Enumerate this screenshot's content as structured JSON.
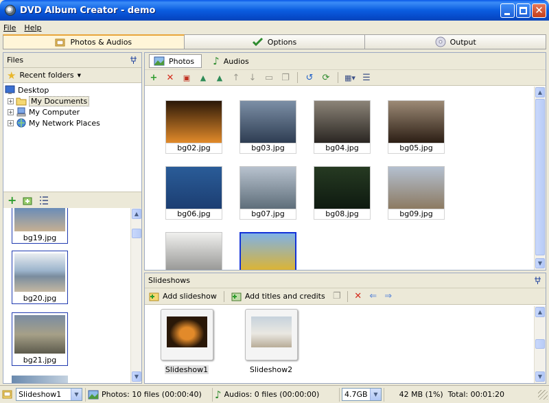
{
  "window": {
    "title": "DVD Album Creator - demo"
  },
  "menu": {
    "file": "File",
    "help": "Help"
  },
  "main_tabs": [
    {
      "label": "Photos & Audios",
      "icon": "photos-audios-icon",
      "active": true
    },
    {
      "label": "Options",
      "icon": "options-check-icon",
      "active": false
    },
    {
      "label": "Output",
      "icon": "disc-icon",
      "active": false
    }
  ],
  "files_panel": {
    "title": "Files",
    "recent_folders": "Recent folders",
    "tree": [
      {
        "label": "Desktop",
        "icon": "desktop-icon",
        "level": 0
      },
      {
        "label": "My Documents",
        "icon": "folder-icon",
        "level": 1,
        "selected": true
      },
      {
        "label": "My Computer",
        "icon": "computer-icon",
        "level": 1
      },
      {
        "label": "My Network Places",
        "icon": "network-icon",
        "level": 1
      }
    ],
    "strip_files": [
      "bg19.jpg",
      "bg20.jpg",
      "bg21.jpg"
    ]
  },
  "photos_panel": {
    "tabs": [
      {
        "label": "Photos",
        "icon": "photo-icon",
        "active": true
      },
      {
        "label": "Audios",
        "icon": "music-note-icon",
        "active": false
      }
    ],
    "thumbnails": [
      {
        "name": "bg02.jpg",
        "c1": "#2A1808",
        "c2": "#E28A2A"
      },
      {
        "name": "bg03.jpg",
        "c1": "#7C8FA6",
        "c2": "#2E3D52"
      },
      {
        "name": "bg04.jpg",
        "c1": "#8C8478",
        "c2": "#2A2622"
      },
      {
        "name": "bg05.jpg",
        "c1": "#9C8A76",
        "c2": "#2C1E14"
      },
      {
        "name": "bg06.jpg",
        "c1": "#2A5C98",
        "c2": "#1C3E72"
      },
      {
        "name": "bg07.jpg",
        "c1": "#B8C2CE",
        "c2": "#5E6E7A"
      },
      {
        "name": "bg08.jpg",
        "c1": "#263A22",
        "c2": "#0E1A10"
      },
      {
        "name": "bg09.jpg",
        "c1": "#B4C0D0",
        "c2": "#8C7A62"
      },
      {
        "name": "",
        "c1": "#F0F0EE",
        "c2": "#8E8E8C"
      },
      {
        "name": "",
        "c1": "#7FB2E6",
        "c2": "#E6B421"
      }
    ]
  },
  "slideshows_panel": {
    "title": "Slideshows",
    "add_slideshow": "Add slideshow",
    "add_titles": "Add titles and credits",
    "items": [
      {
        "label": "Slideshow1",
        "c1": "#2A1808",
        "c2": "#E28A2A"
      },
      {
        "label": "Slideshow2",
        "c1": "#C6D2DC",
        "c2": "#E8E6E0"
      }
    ]
  },
  "status": {
    "slideshow_select": "Slideshow1",
    "photos": "Photos: 10 files (00:00:40)",
    "audios": "Audios: 0 files (00:00:00)",
    "disc_size": "4.7GB",
    "size_total": "42 MB (1%)  Total: 00:01:20"
  },
  "colors": {
    "title_bar": "#0A5CE4",
    "active_tab": "#FFF5D8",
    "selection_border": "#1231D8"
  }
}
